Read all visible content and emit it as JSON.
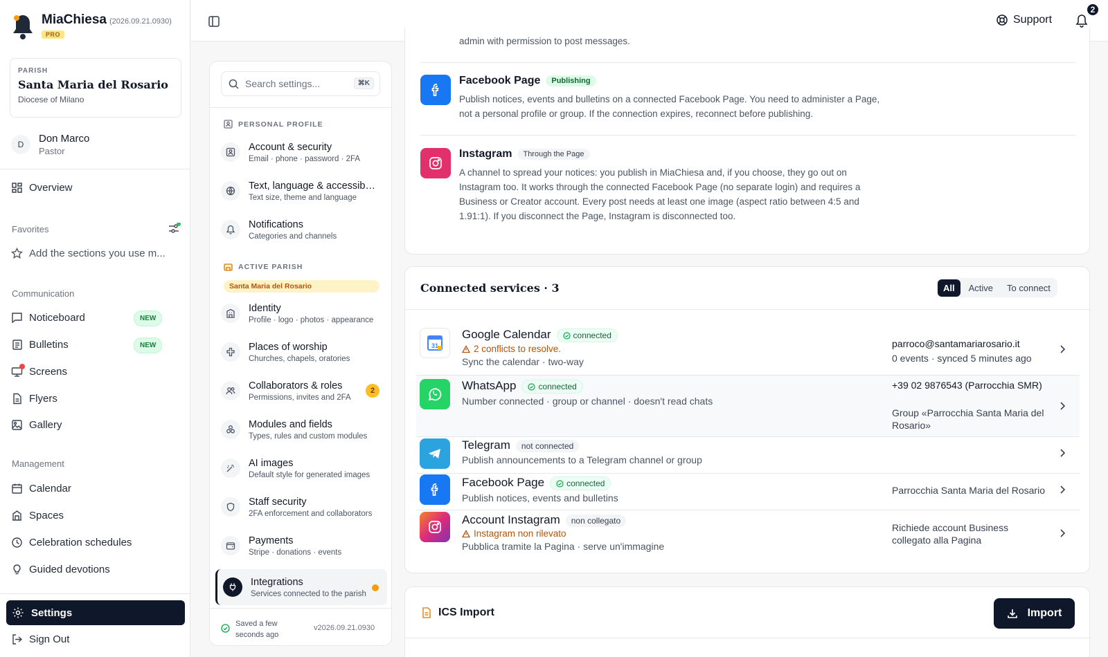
{
  "app": {
    "name": "MiaChiesa",
    "version": "(2026.09.21.0930)",
    "tier": "PRO"
  },
  "parish": {
    "eyebrow": "PARISH",
    "name": "Santa Maria del Rosario",
    "diocese": "Diocese of Milano"
  },
  "user": {
    "initial": "D",
    "name": "Don Marco",
    "role": "Pastor"
  },
  "nav": {
    "overview": "Overview",
    "favorites_label": "Favorites",
    "favorites_empty": "Add the sections you use m...",
    "communication_label": "Communication",
    "communication": [
      {
        "label": "Noticeboard",
        "badge": "NEW"
      },
      {
        "label": "Bulletins",
        "badge": "NEW"
      },
      {
        "label": "Screens"
      },
      {
        "label": "Flyers"
      },
      {
        "label": "Gallery"
      }
    ],
    "management_label": "Management",
    "management": [
      {
        "label": "Calendar"
      },
      {
        "label": "Spaces"
      },
      {
        "label": "Celebration schedules"
      },
      {
        "label": "Guided devotions"
      }
    ],
    "settings": "Settings",
    "signout": "Sign Out"
  },
  "topbar": {
    "support": "Support",
    "notifications": "2"
  },
  "settings_panel": {
    "search_placeholder": "Search settings...",
    "shortcut": "⌘K",
    "personal_header": "PERSONAL PROFILE",
    "personal": [
      {
        "title": "Account & security",
        "sub": "Email · phone · password · 2FA"
      },
      {
        "title": "Text, language & accessibility",
        "sub": "Text size, theme and language"
      },
      {
        "title": "Notifications",
        "sub": "Categories and channels"
      }
    ],
    "parish_header": "ACTIVE PARISH",
    "parish_chip": "Santa Maria del Rosario",
    "parish_items": [
      {
        "title": "Identity",
        "sub": "Profile · logo · photos · appearance"
      },
      {
        "title": "Places of worship",
        "sub": "Churches, chapels, oratories"
      },
      {
        "title": "Collaborators & roles",
        "sub": "Permissions, invites and 2FA",
        "count": "2"
      },
      {
        "title": "Modules and fields",
        "sub": "Types, rules and custom modules"
      },
      {
        "title": "AI images",
        "sub": "Default style for generated images"
      },
      {
        "title": "Staff security",
        "sub": "2FA enforcement and collaborators"
      },
      {
        "title": "Payments",
        "sub": "Stripe · donations · events"
      },
      {
        "title": "Integrations",
        "sub": "Services connected to the parish"
      }
    ],
    "saved": "Saved a few seconds ago",
    "version": "v2026.09.21.0930"
  },
  "channels": {
    "truncated_text": "admin with permission to post messages.",
    "facebook": {
      "title": "Facebook Page",
      "tag": "Publishing",
      "desc": "Publish notices, events and bulletins on a connected Facebook Page. You need to administer a Page, not a personal profile or group. If the connection expires, reconnect before publishing."
    },
    "instagram": {
      "title": "Instagram",
      "tag": "Through the Page",
      "desc": "A channel to spread your notices: you publish in MiaChiesa and, if you choose, they go out on Instagram too. It works through the connected Facebook Page (no separate login) and requires a Business or Creator account. Every post needs at least one image (aspect ratio between 4:5 and 1.91:1). If you disconnect the Page, Instagram is disconnected too."
    }
  },
  "connected": {
    "title": "Connected services · 3",
    "filters": [
      "All",
      "Active",
      "To connect"
    ],
    "services": [
      {
        "name": "Google Calendar",
        "status": "connected",
        "warning": "2 conflicts to resolve.",
        "sub": "Sync the calendar · two-way",
        "right1": "parroco@santamariarosario.it",
        "right2": "0 events · synced 5 minutes ago"
      },
      {
        "name": "WhatsApp",
        "status": "connected",
        "sub": "Number connected · group or channel · doesn't read chats",
        "right1": "+39 02 9876543 (Parrocchia SMR)",
        "right2": "Group «Parrocchia Santa Maria del Rosario»"
      },
      {
        "name": "Telegram",
        "status": "not connected",
        "sub": "Publish announcements to a Telegram channel or group"
      },
      {
        "name": "Facebook Page",
        "status": "connected",
        "sub": "Publish notices, events and bulletins",
        "right1": "Parrocchia Santa Maria del Rosario"
      },
      {
        "name": "Account Instagram",
        "status": "non collegato",
        "warning": "Instagram non rilevato",
        "sub": "Pubblica tramite la Pagina · serve un'immagine",
        "right1": "Richiede account Business collegato alla Pagina"
      }
    ]
  },
  "ics": {
    "title": "ICS Import",
    "button": "Import"
  },
  "colors": {
    "primary": "#0f172a",
    "facebook": "#1877f2",
    "whatsapp": "#25d366",
    "telegram": "#2aa3df",
    "instagram": "#e1306c",
    "warning": "#b45309",
    "success": "#166534"
  }
}
